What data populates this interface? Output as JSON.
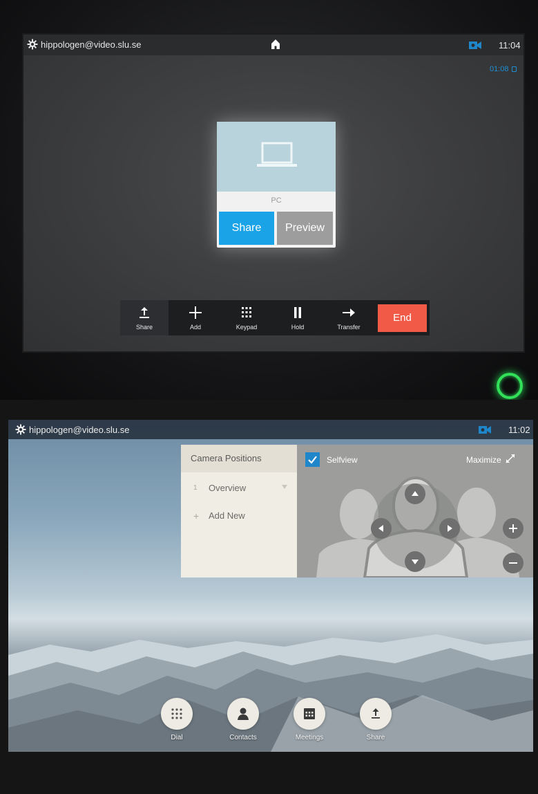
{
  "call_screen": {
    "header": {
      "user": "hippologen@video.slu.se",
      "time": "11:04",
      "icons": [
        "gear-icon",
        "home-icon",
        "camera-icon"
      ]
    },
    "call_timer": "01:08",
    "share_card": {
      "source_label": "PC",
      "share_label": "Share",
      "preview_label": "Preview",
      "accent": "#1aa3e6"
    },
    "toolbar": {
      "share": "Share",
      "add": "Add",
      "keypad": "Keypad",
      "hold": "Hold",
      "transfer": "Transfer",
      "end": "End",
      "end_color": "#f05a47"
    }
  },
  "home_screen": {
    "header": {
      "user": "hippologen@video.slu.se",
      "time": "11:02"
    },
    "camera_panel": {
      "title": "Camera Positions",
      "positions": [
        {
          "num": "1",
          "label": "Overview"
        }
      ],
      "add_new_symbol": "+",
      "add_new": "Add New",
      "selfview": "Selfview",
      "selfview_checked": true,
      "maximize": "Maximize"
    },
    "dock": {
      "dial": "Dial",
      "contacts": "Contacts",
      "meetings": "Meetings",
      "share": "Share"
    }
  }
}
